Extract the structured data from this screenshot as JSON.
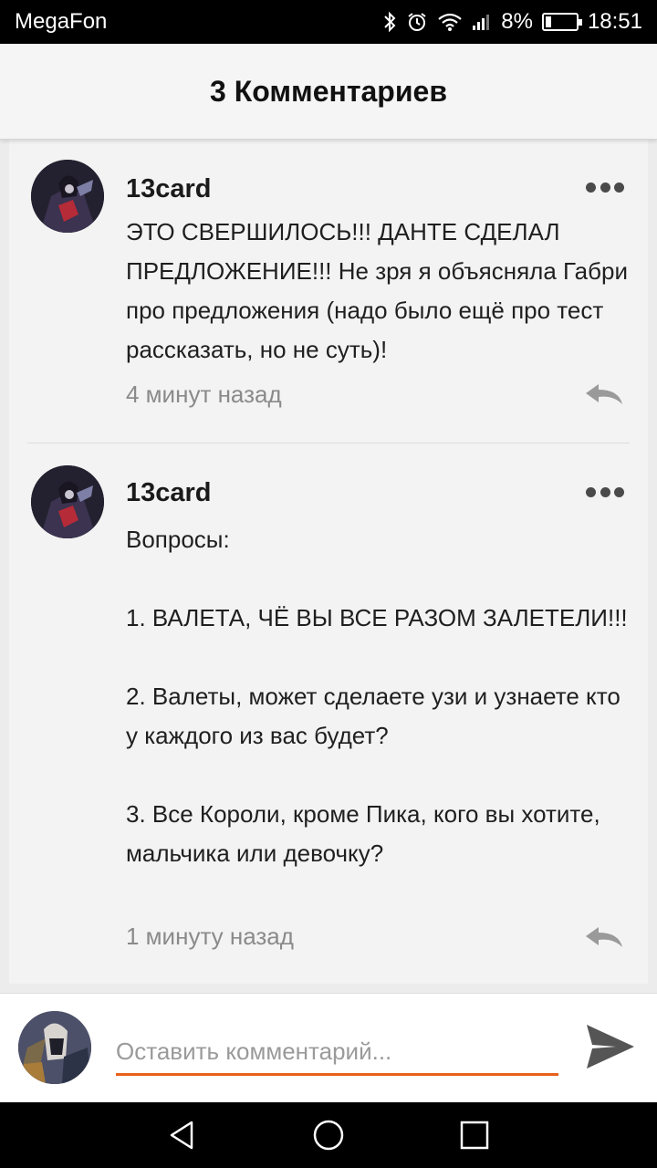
{
  "status_bar": {
    "carrier": "MegaFon",
    "battery": "8%",
    "time": "18:51"
  },
  "header": {
    "title": "3 Комментариев"
  },
  "comments": [
    {
      "username": "13card",
      "text": "ЭТО СВЕРШИЛОСЬ!!! ДАНТЕ СДЕЛАЛ ПРЕДЛОЖЕНИЕ!!! Не зря я объясняла Габри про предложения (надо было ещё про тест рассказать, но не суть)!",
      "time": "4 минут назад"
    },
    {
      "username": "13card",
      "text": "Вопросы:\n\n1. ВАЛЕТА, ЧЁ ВЫ ВСЕ РАЗОМ ЗАЛЕТЕЛИ!!!\n\n2. Валеты, может сделаете узи и узнаете кто у каждого из вас будет?\n\n3. Все Короли, кроме Пика, кого вы хотите, мальчика или девочку?",
      "time": "1 минуту назад"
    }
  ],
  "input": {
    "placeholder": "Оставить комментарий..."
  },
  "colors": {
    "accent": "#e8601c",
    "background": "#ececec",
    "card": "#f3f3f3"
  },
  "icons": [
    "bluetooth-icon",
    "alarm-icon",
    "wifi-icon",
    "signal-icon",
    "battery-icon",
    "more-icon",
    "reply-icon",
    "send-icon",
    "back-icon",
    "home-icon",
    "recent-apps-icon"
  ]
}
